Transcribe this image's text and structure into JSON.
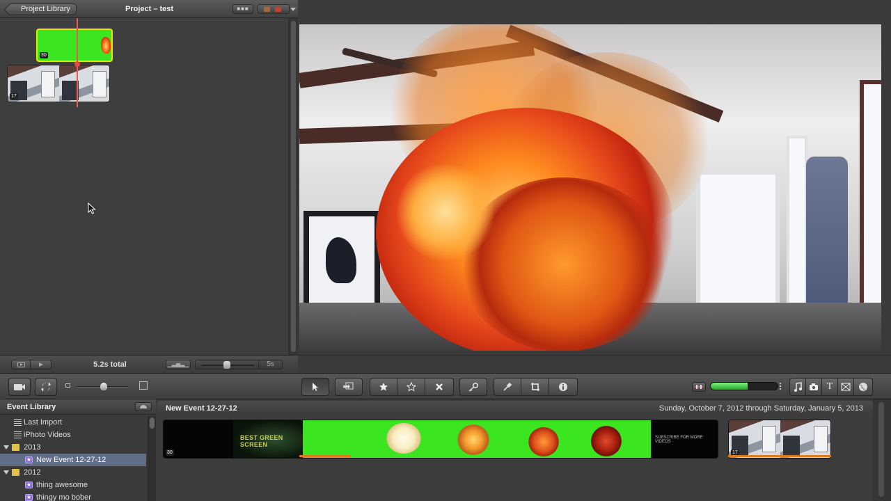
{
  "project": {
    "back_label": "Project Library",
    "title": "Project – test",
    "total_duration": "5.2s total",
    "clip_seconds": "5s",
    "green_clip_badge": "30",
    "room_clip_badge": "17"
  },
  "toolbar": {
    "import_icon": "camera-import-icon",
    "swap_icon": "swap-arrows-icon",
    "select_icon": "arrow-pointer-icon",
    "add_selection_icon": "add-to-project-icon",
    "favorite_icon": "filled-star-icon",
    "unmark_icon": "outline-star-icon",
    "reject_icon": "x-reject-icon",
    "keyword_icon": "key-icon",
    "dropper_icon": "eyedropper-icon",
    "crop_icon": "crop-icon",
    "inspector_icon": "info-icon",
    "music_icon": "music-note-icon",
    "photo_icon": "camera-icon",
    "title_icon": "title-t-icon",
    "transitions_icon": "transitions-icon",
    "maps_icon": "globe-icon",
    "volume_level": 0.55
  },
  "event_library": {
    "title": "Event Library",
    "items": [
      {
        "label": "Last Import",
        "type": "list",
        "indent": 0
      },
      {
        "label": "iPhoto Videos",
        "type": "list",
        "indent": 0
      },
      {
        "label": "2013",
        "type": "folder",
        "expanded": true
      },
      {
        "label": "New Event 12-27-12",
        "type": "event",
        "selected": true
      },
      {
        "label": "2012",
        "type": "folder",
        "expanded": true
      },
      {
        "label": "thing awesome",
        "type": "event"
      },
      {
        "label": "thingy mo bober",
        "type": "event"
      }
    ]
  },
  "event_browser": {
    "event_name": "New Event 12-27-12",
    "date_range": "Sunday, October 7, 2012 through Saturday, January 5, 2013",
    "strip_badge": "30",
    "room_badge": "17",
    "card_text_1": "BEST GREEN SCREEN",
    "card_text_2": "SUBSCRIBE FOR MORE VIDEOS"
  },
  "colors": {
    "accent_selection": "#5f6d87",
    "green_screen": "#3be51f",
    "clip_selection_border": "#e7e600",
    "playhead": "#e85a5a",
    "used_clip_bar": "#e07c1d"
  }
}
